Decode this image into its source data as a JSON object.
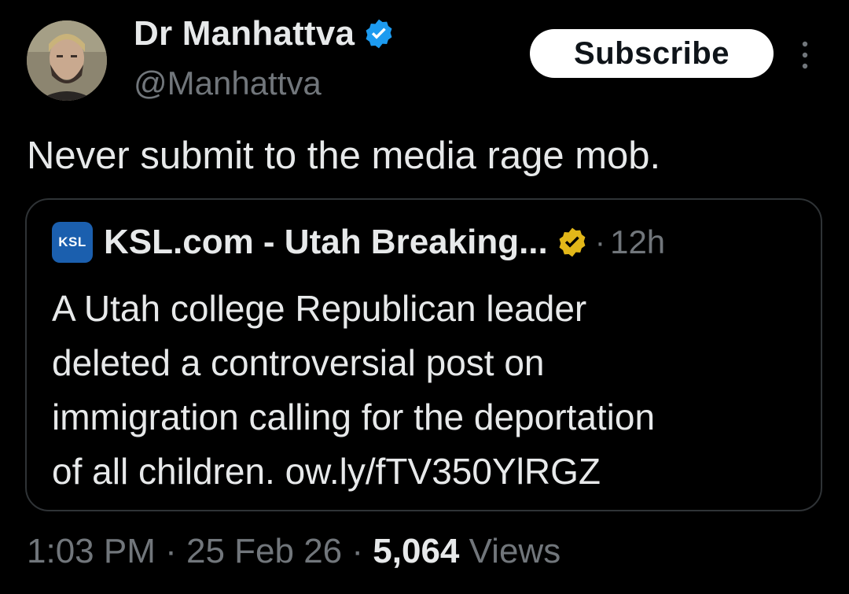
{
  "author": {
    "display_name": "Dr Manhattva",
    "handle": "@Manhattva",
    "verified_color": "#1d9bf0"
  },
  "subscribe_label": "Subscribe",
  "tweet_text": "Never submit to the media rage mob.",
  "quote": {
    "logo_text": "KSL",
    "logo_color": "#1b5fae",
    "name": "KSL.com - Utah Breaking...",
    "verified_color": "#e2b719",
    "separator": "·",
    "time": "12h",
    "lines": [
      "A Utah college Republican leader",
      "deleted a controversial post on",
      "immigration calling for the deportation",
      "of all children. ow.ly/fTV350YlRGZ"
    ]
  },
  "meta": {
    "time": "1:03 PM",
    "date": "25 Feb 26",
    "views_count": "5,064",
    "views_label": "Views",
    "separator": "·"
  },
  "icons": {
    "avatar": "avatar",
    "verified": "verified-badge-icon",
    "more": "more-vertical-icon"
  }
}
